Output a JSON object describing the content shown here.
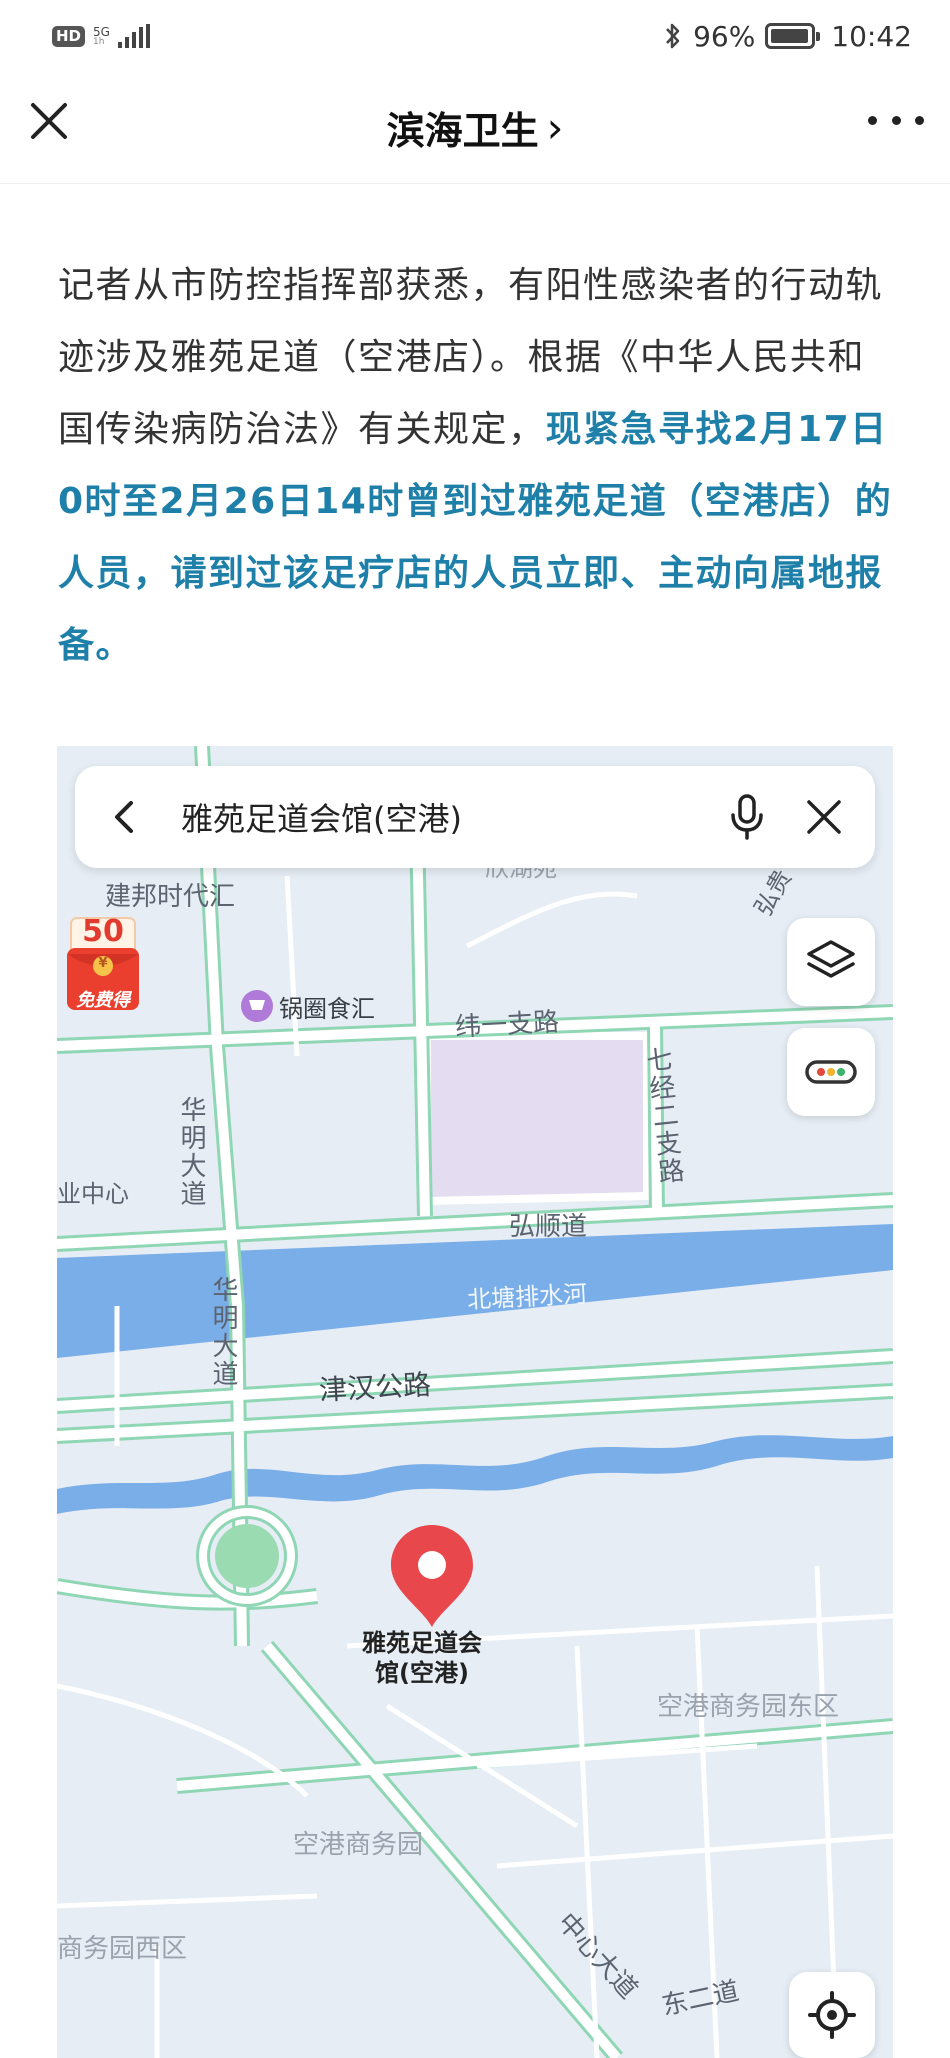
{
  "status_bar": {
    "hd": "HD",
    "network_top": "5G",
    "network_bottom": "1h",
    "battery": "96%",
    "time": "10:42"
  },
  "nav": {
    "title": "滨海卫生",
    "chevron": "›"
  },
  "article": {
    "plain": "记者从市防控指挥部获悉，有阳性感染者的行动轨迹涉及雅苑足道（空港店）。根据《中华人民共和国传染病防治法》有关规定，",
    "highlight": "现紧急寻找2月17日0时至2月26日14时曾到过雅苑足道（空港店）的人员，请到过该足疗店的人员立即、主动向属地报备。",
    "highlight_color": "#1e7fa8"
  },
  "map": {
    "search_query": "雅苑足道会馆(空港)",
    "promo_amount": "50",
    "promo_coin": "¥",
    "promo_label": "免费得",
    "pin_label_line1": "雅苑足道会",
    "pin_label_line2": "馆(空港)",
    "pin_color": "#e8474b",
    "river_color": "#7aaee8",
    "road_edge_color": "#8fd6b4",
    "labels": {
      "jianbang": "建邦时代汇",
      "guoquan": "锅圈食汇",
      "weiyi": "纬一支路",
      "jinger": "七经二支路",
      "hongshun": "弘顺道",
      "beitang": "北塘排水河",
      "jinhan": "津汉公路",
      "huaming_upper": "华明大道",
      "huaming_lower": "华明大道",
      "yezhongxin": "业中心",
      "airport_east": "空港商务园东区",
      "airport": "空港商务园",
      "airport_west": "商务园西区",
      "zhongxin": "中心大道",
      "donger": "东二道",
      "hong_top": "弘贵",
      "xinhu": "欣湖苑"
    }
  },
  "icons": {
    "close": "close-icon",
    "more": "more-dots-icon",
    "back": "back-arrow-icon",
    "mic": "microphone-icon",
    "clear": "clear-icon",
    "layers": "layers-icon",
    "traffic": "traffic-icon",
    "locate": "locate-icon",
    "bluetooth": "bluetooth-icon",
    "signal": "signal-icon",
    "battery": "battery-icon",
    "pin": "location-pin-icon",
    "cart": "shopping-cart-icon"
  }
}
